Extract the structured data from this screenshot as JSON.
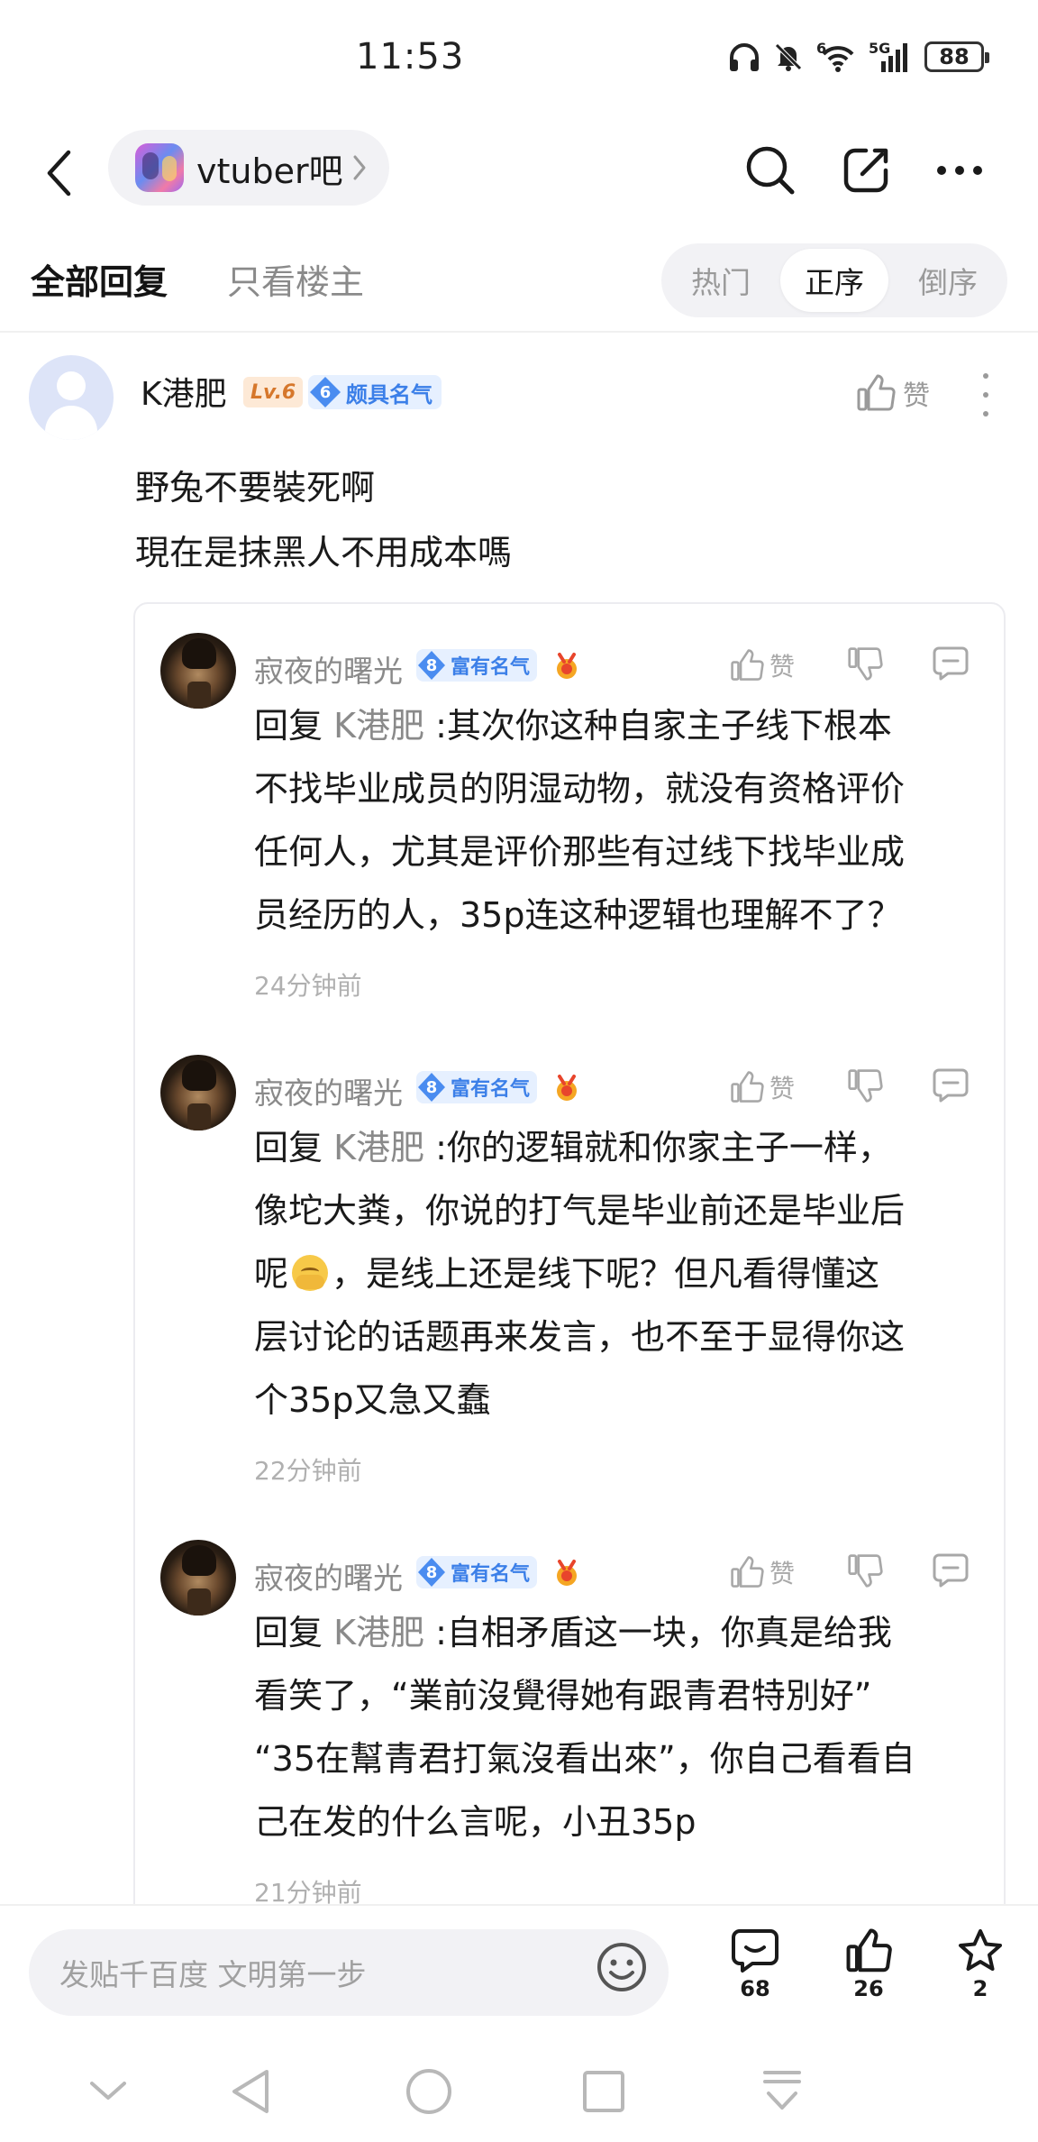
{
  "status_bar": {
    "time": "11:53",
    "battery": "88",
    "wifi_label": "6",
    "cell_label": "5G",
    "icons": [
      "headphones-icon",
      "mute-bell-icon",
      "wifi-icon",
      "signal-icon",
      "battery-icon"
    ]
  },
  "nav": {
    "forum_name": "vtuber吧",
    "icons": [
      "back-chevron-icon",
      "search-icon",
      "edit-icon",
      "more-dots-icon"
    ]
  },
  "tabs": {
    "all": "全部回复",
    "op_only": "只看楼主",
    "sort": {
      "hot": "热门",
      "asc": "正序",
      "desc": "倒序",
      "selected": "正序"
    }
  },
  "main_post": {
    "author": "K港肥",
    "level": "Lv.6",
    "fame_level": "6",
    "fame_label": "颇具名气",
    "like_label": "赞",
    "lines": [
      "野兔不要裝死啊",
      "現在是抹黑人不用成本嗎"
    ]
  },
  "replies": [
    {
      "author": "寂夜的曙光",
      "fame_level": "8",
      "fame_label": "富有名气",
      "like_label": "赞",
      "prefix": "回复 ",
      "mention": "K港肥",
      "lines": [
        " :其次你这种自家主子线下根本",
        "不找毕业成员的阴湿动物，就没有资格评价",
        "任何人，尤其是评价那些有过线下找毕业成",
        "员经历的人，35p连这种逻辑也理解不了？"
      ],
      "time": "24分钟前"
    },
    {
      "author": "寂夜的曙光",
      "fame_level": "8",
      "fame_label": "富有名气",
      "like_label": "赞",
      "prefix": "回复 ",
      "mention": "K港肥",
      "lines": [
        " :你的逻辑就和你家主子一样，",
        "像坨大粪，你说的打气是毕业前还是毕业后",
        "呢",
        "，是线上还是线下呢？但凡看得懂这",
        "层讨论的话题再来发言，也不至于显得你这",
        "个35p又急又蠢"
      ],
      "time": "22分钟前"
    },
    {
      "author": "寂夜的曙光",
      "fame_level": "8",
      "fame_label": "富有名气",
      "like_label": "赞",
      "prefix": "回复 ",
      "mention": "K港肥",
      "lines": [
        " :自相矛盾这一块，你真是给我",
        "看笑了，“業前沒覺得她有跟青君特別好”",
        "“35在幫青君打氣沒看出來”，你自己看看自",
        "己在发的什么言呢，小丑35p"
      ],
      "time": "21分钟前"
    }
  ],
  "bottom_bar": {
    "input_placeholder": "发贴千百度 文明第一步",
    "comments_count": "68",
    "likes_count": "26",
    "favorites_count": "2"
  },
  "colors": {
    "accent_blue": "#3b7fe8",
    "muted_text": "#8a8a8a",
    "pill_bg": "#f2f2f5"
  }
}
